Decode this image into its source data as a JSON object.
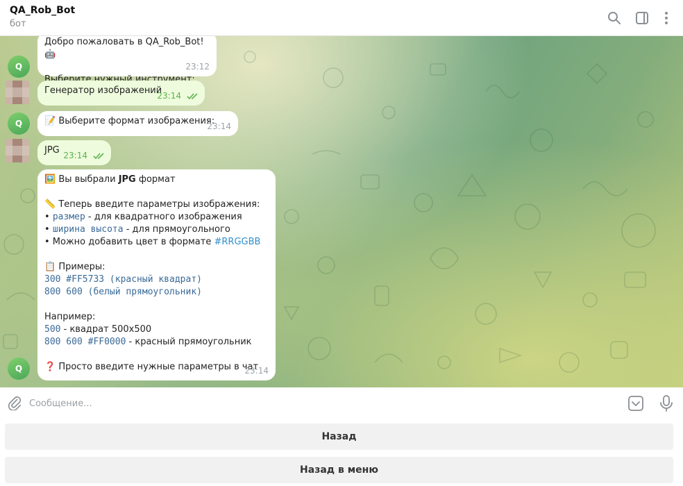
{
  "header": {
    "title": "QA_Rob_Bot",
    "subtitle": "бот",
    "icons": [
      "search-icon",
      "sidebar-toggle-icon",
      "more-vertical-icon"
    ]
  },
  "messages": [
    {
      "id": 1,
      "from": "bot",
      "lines": [
        "Добро пожаловать в QA_Rob_Bot! 🤖",
        "",
        "Выберите нужный инструмент:"
      ],
      "time": "23:12",
      "avatar_letter": "Q"
    },
    {
      "id": 2,
      "from": "user",
      "text": "Генератор изображений",
      "time": "23:14"
    },
    {
      "id": 3,
      "from": "bot",
      "text": "📝 Выберите формат изображения:",
      "time": "23:14",
      "avatar_letter": "Q"
    },
    {
      "id": 4,
      "from": "user",
      "text": "JPG",
      "time": "23:14"
    },
    {
      "id": 5,
      "from": "bot",
      "time": "23:14",
      "avatar_letter": "Q",
      "l1_prefix": "🖼️ Вы выбрали ",
      "l1_bold": "JPG",
      "l1_suffix": " формат",
      "l2": "📏 Теперь введите параметры изображения:",
      "l3_bullet": "• ",
      "l3_code": "размер",
      "l3_rest": " - для квадратного изображения",
      "l4_bullet": "• ",
      "l4_code": "ширина высота",
      "l4_rest": " - для прямоугольного",
      "l5_text": "• Можно добавить цвет в формате ",
      "l5_link": "#RRGGBB",
      "l6": "📋 Примеры:",
      "l7_code": "300 #FF5733 (красный квадрат)",
      "l8_code": "800 600 (белый прямоугольник)",
      "l9": "Например:",
      "l10_code": "500",
      "l10_rest": " - квадрат 500x500",
      "l11_code": "800 600 #FF0000",
      "l11_rest": " - красный прямоугольник",
      "l12": "❓ Просто введите нужные параметры в чат"
    }
  ],
  "composer": {
    "placeholder": "Сообщение..."
  },
  "keyboard": {
    "buttons": [
      "Назад",
      "Назад в меню"
    ]
  }
}
